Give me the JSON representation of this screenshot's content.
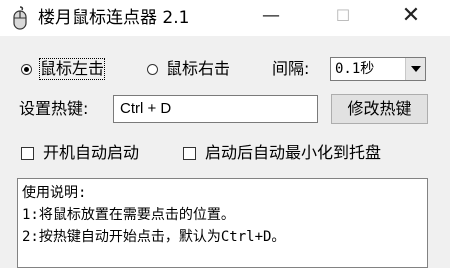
{
  "window": {
    "title": "楼月鼠标连点器 2.1",
    "controls": {
      "minimize": "—",
      "maximize": "☐",
      "close": "✕"
    }
  },
  "mode": {
    "left_label": "鼠标左击",
    "right_label": "鼠标右击",
    "selected": "left"
  },
  "interval": {
    "label": "间隔:",
    "value": "0.1秒"
  },
  "hotkey": {
    "label": "设置热键:",
    "value": "Ctrl + D",
    "change_button": "修改热键"
  },
  "options": {
    "startup_label": "开机自动启动",
    "minimize_label": "启动后自动最小化到托盘",
    "startup_checked": false,
    "minimize_checked": false
  },
  "instructions": {
    "lines": [
      "使用说明:",
      "1:将鼠标放置在需要点击的位置。",
      "2:按热键自动开始点击，默认为Ctrl+D。"
    ]
  },
  "icons": {
    "app": "mouse-icon",
    "dropdown": "chevron-down-icon"
  }
}
